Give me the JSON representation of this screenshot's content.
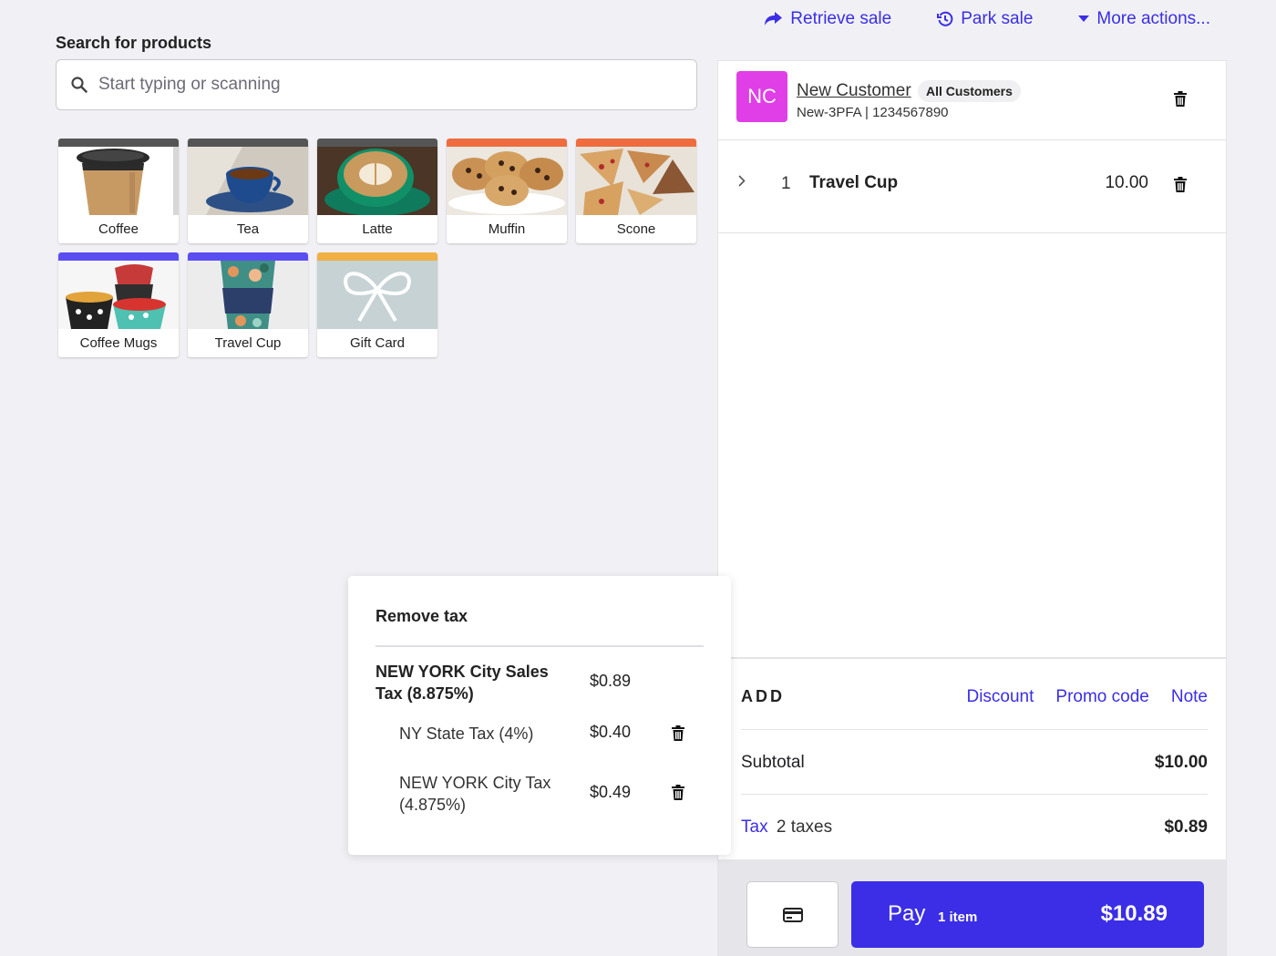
{
  "top_actions": {
    "retrieve": "Retrieve sale",
    "park": "Park sale",
    "more": "More actions..."
  },
  "search": {
    "label": "Search for products",
    "placeholder": "Start typing or scanning"
  },
  "products": [
    {
      "name": "Coffee",
      "bar_color": "#555555"
    },
    {
      "name": "Tea",
      "bar_color": "#555555"
    },
    {
      "name": "Latte",
      "bar_color": "#555555"
    },
    {
      "name": "Muffin",
      "bar_color": "#ef6c3f"
    },
    {
      "name": "Scone",
      "bar_color": "#ef6c3f"
    },
    {
      "name": "Coffee Mugs",
      "bar_color": "#5b4ef1"
    },
    {
      "name": "Travel Cup",
      "bar_color": "#5b4ef1"
    },
    {
      "name": "Gift Card",
      "bar_color": "#f0b043"
    }
  ],
  "customer": {
    "initials": "NC",
    "name": "New Customer",
    "group": "All Customers",
    "details": "New-3PFA | 1234567890"
  },
  "line_items": [
    {
      "qty": "1",
      "name": "Travel Cup",
      "price": "10.00"
    }
  ],
  "add": {
    "label": "ADD",
    "discount": "Discount",
    "promo": "Promo code",
    "note": "Note"
  },
  "totals": {
    "subtotal_label": "Subtotal",
    "subtotal_value": "$10.00",
    "tax_label": "Tax",
    "tax_count": "2 taxes",
    "tax_value": "$0.89"
  },
  "pay": {
    "label": "Pay",
    "items": "1 item",
    "amount": "$10.89"
  },
  "tax_popover": {
    "title": "Remove tax",
    "main": {
      "name": "NEW YORK City Sales Tax (8.875%)",
      "amount": "$0.89"
    },
    "components": [
      {
        "name": "NY State Tax (4%)",
        "amount": "$0.40"
      },
      {
        "name": "NEW YORK City Tax (4.875%)",
        "amount": "$0.49"
      }
    ]
  },
  "colors": {
    "accent": "#3b2ee6",
    "avatar": "#e03ee7",
    "background": "#f1f1f5"
  }
}
